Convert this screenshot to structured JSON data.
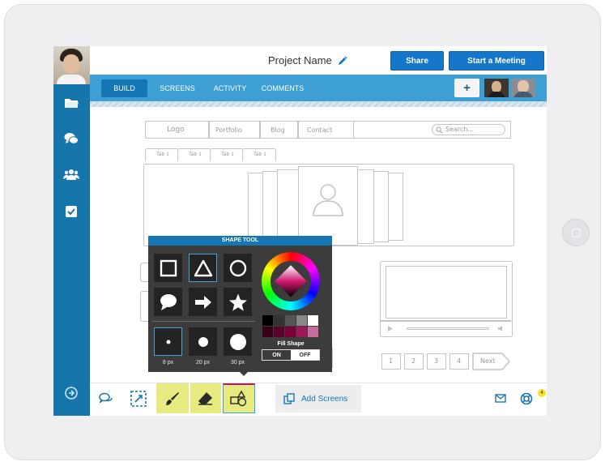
{
  "header": {
    "project_name": "Project Name",
    "share_label": "Share",
    "meeting_label": "Start a Meeting"
  },
  "nav": {
    "tabs": [
      {
        "label": "BUILD",
        "active": true
      },
      {
        "label": "SCREENS",
        "active": false
      },
      {
        "label": "ACTIVITY",
        "active": false
      },
      {
        "label": "COMMENTS",
        "active": false
      }
    ],
    "add_label": "+"
  },
  "sidebar": {
    "icons": [
      "folder-icon",
      "chat-icon",
      "users-icon",
      "checkbox-icon",
      "arrow-right-circle-icon"
    ]
  },
  "wireframe": {
    "nav_items": [
      "Logo",
      "Portfolio",
      "Blog",
      "Contact"
    ],
    "search_placeholder": "Search...",
    "tabs": [
      "Tab 1",
      "Tab 1",
      "Tab 1",
      "Tab 1"
    ],
    "pagination": [
      "1",
      "2",
      "3",
      "4"
    ],
    "next_label": "Next"
  },
  "shape_tool": {
    "title": "SHAPE TOOL",
    "shapes": [
      "square-icon",
      "triangle-icon",
      "circle-icon",
      "speech-bubble-icon",
      "arrow-icon",
      "star-icon"
    ],
    "sizes": [
      "8 px",
      "20 px",
      "30 px"
    ],
    "selected_shape": "triangle",
    "selected_size": "8 px",
    "fill_label": "Fill Shape",
    "fill_on": "ON",
    "fill_off": "OFF",
    "fill_state": "OFF",
    "swatches_row1": [
      "#000000",
      "#333333",
      "#555555",
      "#888888",
      "#ffffff"
    ],
    "swatches_row2": [
      "#3a0019",
      "#5a0029",
      "#7a0038",
      "#9c1659",
      "#c86a9b"
    ]
  },
  "toolbar": {
    "add_screens_label": "Add Screens",
    "notification_count": "4",
    "highlight_color": "#e7ea7e"
  },
  "colors": {
    "brand_blue": "#1676ab",
    "nav_blue": "#3d9fd3",
    "button_blue": "#1676c9"
  }
}
